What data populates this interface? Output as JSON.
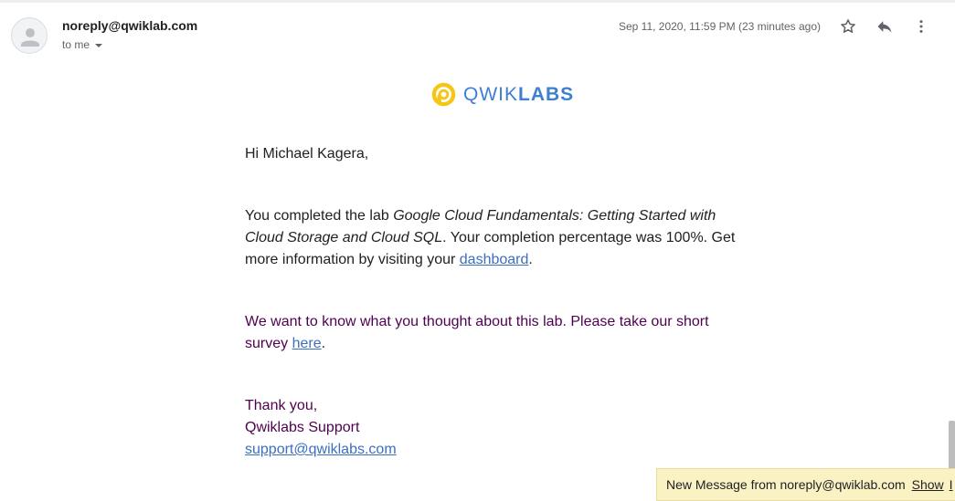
{
  "header": {
    "sender": "noreply@qwiklab.com",
    "recipient_label": "to me",
    "date": "Sep 11, 2020, 11:59 PM (23 minutes ago)"
  },
  "icons": {
    "avatar": "person-icon",
    "star": "star-icon",
    "reply": "reply-icon",
    "more": "more-vert-icon",
    "logo": "qwiklabs-logo-icon"
  },
  "logo": {
    "part1": "QWIK",
    "part2": "LABS"
  },
  "body": {
    "greeting": "Hi Michael Kagera,",
    "p1_before": "You completed the lab ",
    "p1_lab": "Google Cloud Fundamentals: Getting Started with Cloud Storage and Cloud SQL",
    "p1_after": ". Your completion percentage was 100%. Get more information by visiting your ",
    "p1_link": "dashboard",
    "p1_end": ".",
    "p2_before": "We want to know what you thought about this lab. Please take our short survey ",
    "p2_link": "here",
    "p2_end": ".",
    "sign1": "Thank you,",
    "sign2": "Qwiklabs Support",
    "sign_email": "support@qwiklabs.com"
  },
  "notification": {
    "text": "New Message from noreply@qwiklab.com",
    "show": "Show",
    "extra": "I"
  },
  "colors": {
    "logo_yellow": "#f5c518",
    "logo_blue": "#3f7fd1",
    "link": "#3b6fc0",
    "quoted_text": "#500050",
    "notification_bg": "#fbf2c4"
  }
}
